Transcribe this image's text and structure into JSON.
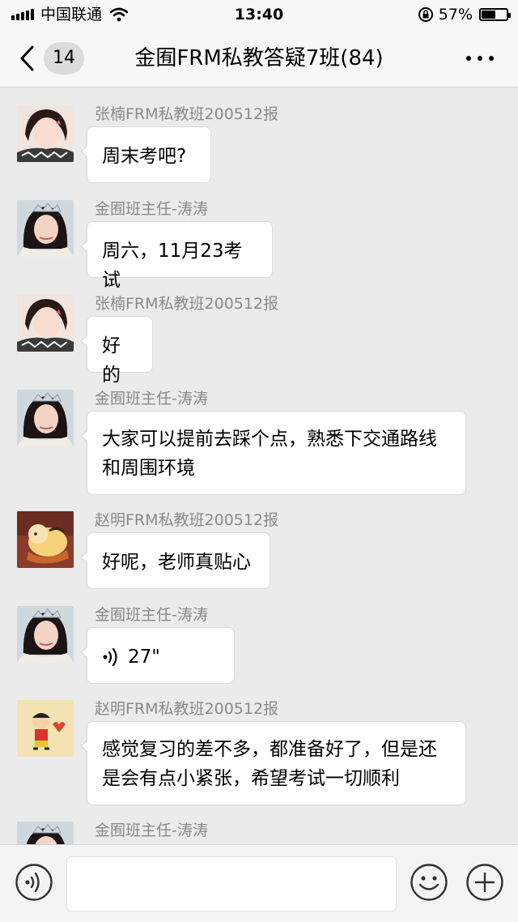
{
  "status_bar": {
    "carrier": "中国联通",
    "time": "13:40",
    "battery_percent": "57%",
    "battery_level": 0.57
  },
  "nav": {
    "unread_count": "14",
    "title": "金囿FRM私教答疑7班(84)",
    "back_icon": "chevron-left-icon",
    "more_icon": "more-dots-icon"
  },
  "messages": [
    {
      "sender": "张楠FRM私教班200512报",
      "text": "周末考吧?",
      "avatar": "avatar-girl-1",
      "type": "text"
    },
    {
      "sender": "金囿班主任-涛涛",
      "text": "周六，11月23考试",
      "avatar": "avatar-girl-2",
      "type": "text"
    },
    {
      "sender": "张楠FRM私教班200512报",
      "text": "好的",
      "avatar": "avatar-girl-1",
      "type": "text"
    },
    {
      "sender": "金囿班主任-涛涛",
      "lines": [
        "大家可以提前去踩个点，熟悉下交通路线",
        "和周围环境"
      ],
      "avatar": "avatar-girl-2",
      "type": "text"
    },
    {
      "sender": "赵明FRM私教班200512报",
      "text": "好呢，老师真贴心",
      "avatar": "avatar-cartoon-1",
      "type": "text"
    },
    {
      "sender": "金囿班主任-涛涛",
      "text": "27\"",
      "avatar": "avatar-girl-2",
      "type": "voice",
      "voice_icon": "voice-wave-icon"
    },
    {
      "sender": "赵明FRM私教班200512报",
      "lines": [
        "感觉复习的差不多，都准备好了，但是还",
        "是会有点小紧张，希望考试一切顺利"
      ],
      "avatar": "avatar-cartoon-2",
      "type": "text"
    },
    {
      "sender": "金囿班主任-涛涛",
      "avatar": "avatar-girl-2",
      "type": "partial"
    }
  ],
  "input_bar": {
    "voice_button_icon": "voice-mode-icon",
    "emoji_button_icon": "emoji-icon",
    "plus_button_icon": "plus-icon"
  },
  "colors": {
    "background": "#ebebeb",
    "bar": "#f7f7f7",
    "bubble": "#ffffff",
    "sender": "#8a8a8a"
  }
}
